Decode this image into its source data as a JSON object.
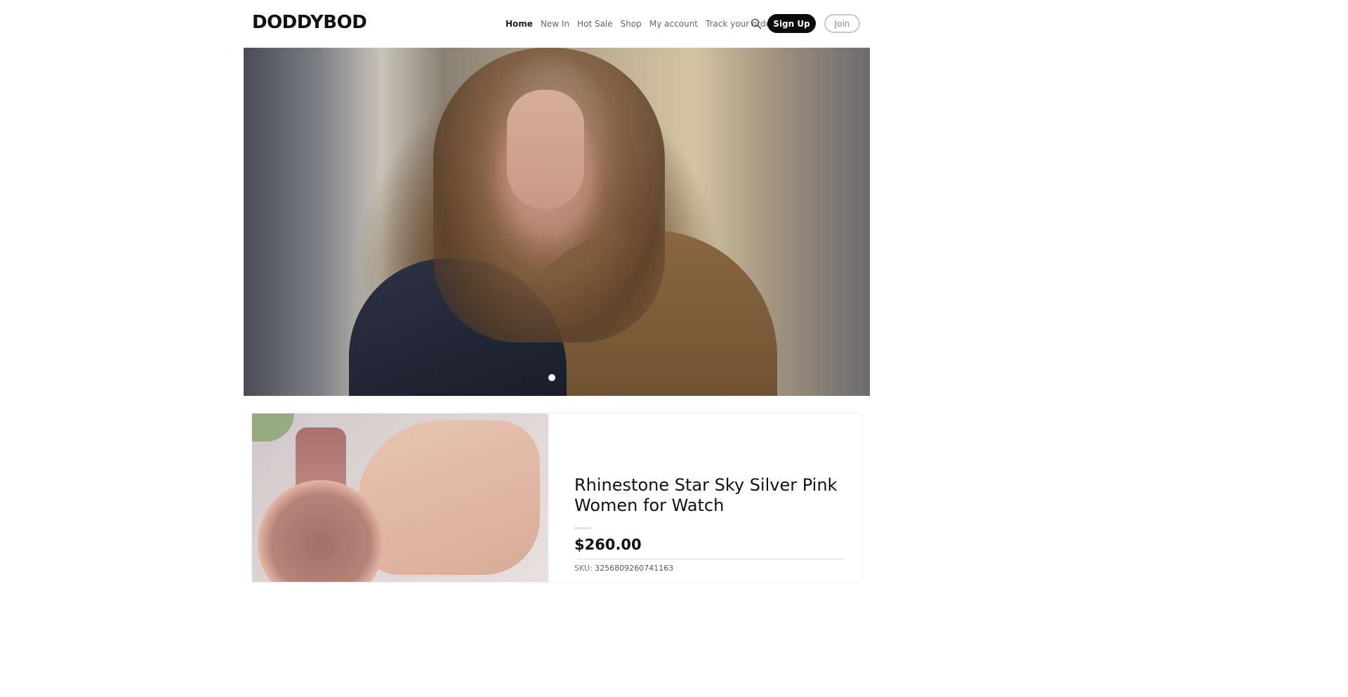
{
  "header": {
    "logo": "DODDYBOD",
    "nav": [
      {
        "label": "Home",
        "active": true
      },
      {
        "label": "New In",
        "active": false
      },
      {
        "label": "Hot Sale",
        "active": false
      },
      {
        "label": "Shop",
        "active": false
      },
      {
        "label": "My account",
        "active": false
      },
      {
        "label": "Track your order",
        "active": false
      }
    ],
    "search_icon": "search-icon",
    "signup_label": "Sign Up",
    "join_label": "Join"
  },
  "hero": {
    "slide_count": 1,
    "active_slide": 1
  },
  "product": {
    "title": "Rhinestone Star Sky Silver Pink Women for Watch",
    "price": "$260.00",
    "sku_label": "SKU:",
    "sku_value": "3256809260741163"
  },
  "colors": {
    "accent": "#0b0b0b",
    "text": "#111111",
    "muted": "#666666"
  }
}
